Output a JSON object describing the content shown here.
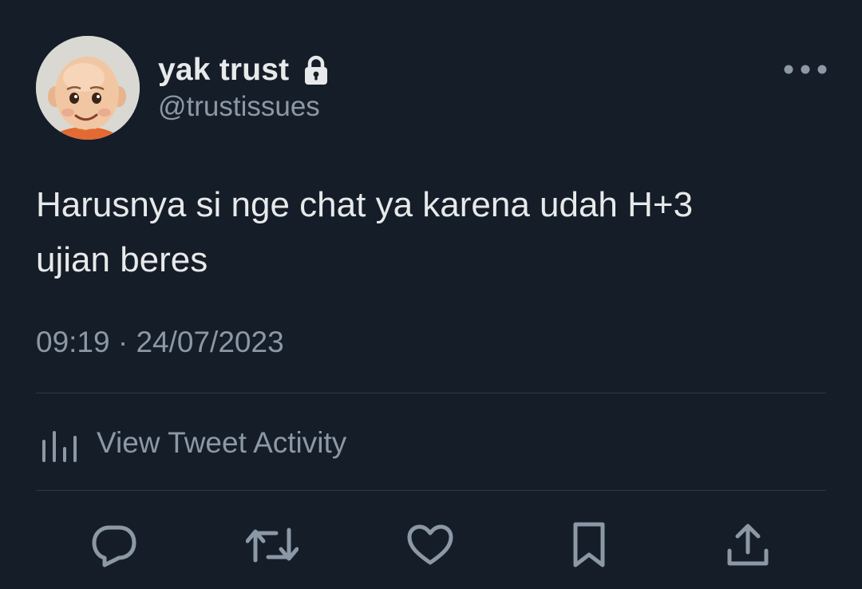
{
  "user": {
    "display_name": "yak trust",
    "handle": "@trustissues",
    "protected_icon": "lock-icon",
    "avatar": "avatar"
  },
  "tweet": {
    "text_lines": [
      "Harusnya si nge chat ya karena udah H+3",
      "ujian beres"
    ],
    "timestamp": "09:19 · 24/07/2023"
  },
  "activity": {
    "label": "View Tweet Activity",
    "icon": "bar-chart-icon"
  },
  "actions": [
    {
      "name": "reply",
      "icon": "reply-icon"
    },
    {
      "name": "retweet",
      "icon": "retweet-icon"
    },
    {
      "name": "like",
      "icon": "heart-icon"
    },
    {
      "name": "bookmark",
      "icon": "bookmark-icon"
    },
    {
      "name": "share",
      "icon": "share-icon"
    }
  ],
  "colors": {
    "background": "#151d28",
    "primary_text": "#e7e9ea",
    "secondary_text": "#8b98a5",
    "divider": "#2f3942"
  }
}
